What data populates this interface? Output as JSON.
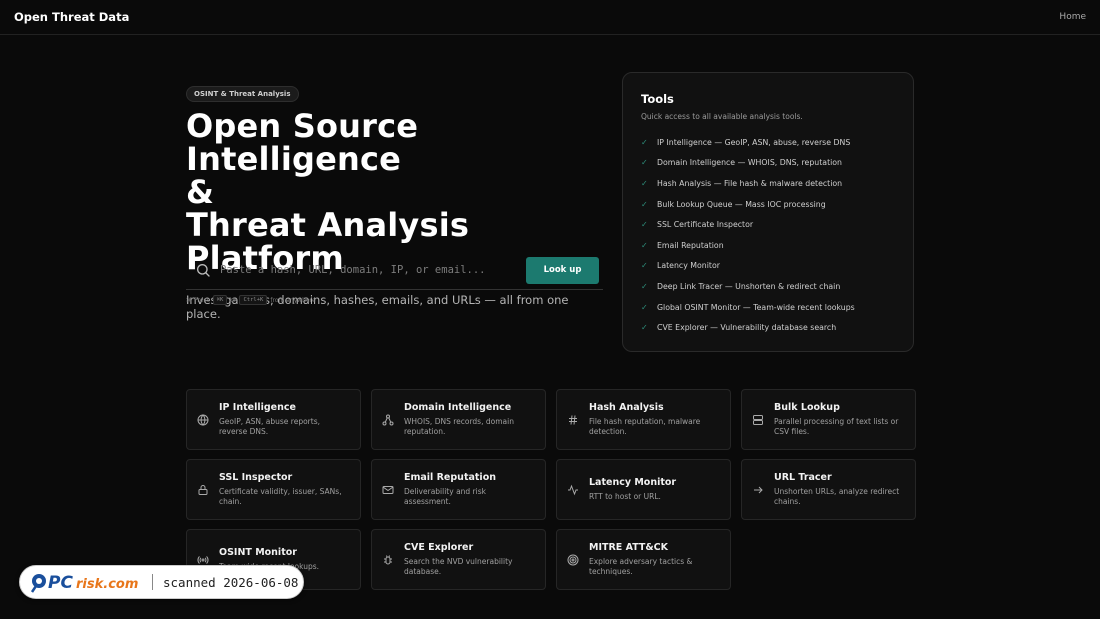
{
  "header": {
    "brand": "Open Threat Data",
    "nav_home": "Home"
  },
  "hero": {
    "badge": "OSINT & Threat Analysis",
    "title_lines": [
      "Open Source Intelligence",
      "&",
      "Threat Analysis Platform"
    ],
    "subtitle": "Investigate IPs, domains, hashes, emails, and URLs — all from one place."
  },
  "search": {
    "placeholder": "Paste a hash, URL, domain, IP, or email...",
    "value": "",
    "button_label": "Look up",
    "hint_prefix": "⌘ Press",
    "hint_key1": "⌘K",
    "hint_or": "or",
    "hint_key2": "Ctrl+K",
    "hint_suffix": "from anywhere"
  },
  "tools": {
    "title": "Tools",
    "subtitle": "Quick access to all available analysis tools.",
    "items": [
      "IP Intelligence — GeoIP, ASN, abuse, reverse DNS",
      "Domain Intelligence — WHOIS, DNS, reputation",
      "Hash Analysis — File hash & malware detection",
      "Bulk Lookup Queue — Mass IOC processing",
      "SSL Certificate Inspector",
      "Email Reputation",
      "Latency Monitor",
      "Deep Link Tracer — Unshorten & redirect chain",
      "Global OSINT Monitor — Team-wide recent lookups",
      "CVE Explorer — Vulnerability database search"
    ]
  },
  "cards": [
    {
      "icon": "globe-icon",
      "title": "IP Intelligence",
      "desc": "GeoIP, ASN, abuse reports, reverse DNS."
    },
    {
      "icon": "network-icon",
      "title": "Domain Intelligence",
      "desc": "WHOIS, DNS records, domain reputation."
    },
    {
      "icon": "hash-icon",
      "title": "Hash Analysis",
      "desc": "File hash reputation, malware detection."
    },
    {
      "icon": "server-icon",
      "title": "Bulk Lookup",
      "desc": "Parallel processing of text lists or CSV files."
    },
    {
      "icon": "lock-icon",
      "title": "SSL Inspector",
      "desc": "Certificate validity, issuer, SANs, chain."
    },
    {
      "icon": "mail-icon",
      "title": "Email Reputation",
      "desc": "Deliverability and risk assessment."
    },
    {
      "icon": "activity-icon",
      "title": "Latency Monitor",
      "desc": "RTT to host or URL."
    },
    {
      "icon": "arrow-right-icon",
      "title": "URL Tracer",
      "desc": "Unshorten URLs, analyze redirect chains."
    },
    {
      "icon": "radio-icon",
      "title": "OSINT Monitor",
      "desc": "Team-wide recent lookups."
    },
    {
      "icon": "bug-icon",
      "title": "CVE Explorer",
      "desc": "Search the NVD vulnerability database."
    },
    {
      "icon": "target-icon",
      "title": "MITRE ATT&CK",
      "desc": "Explore adversary tactics & techniques."
    }
  ],
  "watermark": {
    "logo_text": "PCrisk.com",
    "text": "scanned 2026-06-08"
  },
  "colors": {
    "accent": "#1c7a6f",
    "check": "#2e8f7c",
    "background": "#0a0a0a"
  }
}
